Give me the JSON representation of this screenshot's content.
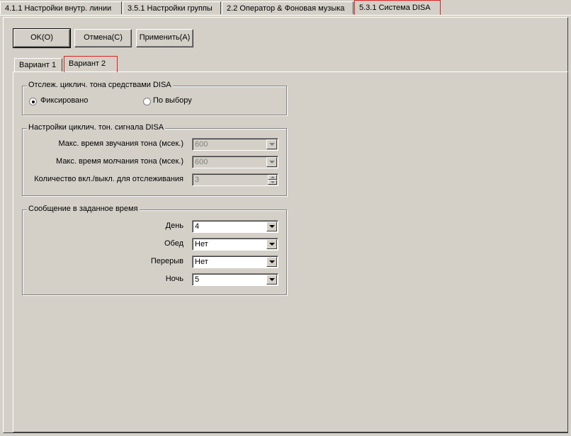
{
  "top_tabs": [
    {
      "label": "4.1.1 Настройки внутр. линии",
      "active": false
    },
    {
      "label": "3.5.1 Настройки группы",
      "active": false
    },
    {
      "label": "2.2 Оператор & Фоновая музыка",
      "active": false
    },
    {
      "label": "5.3.1 Система DISA",
      "active": true
    }
  ],
  "buttons": {
    "ok": "OK(O)",
    "cancel": "Отмена(C)",
    "apply": "Применить(A)"
  },
  "inner_tabs": [
    {
      "label": "Вариант 1",
      "active": false
    },
    {
      "label": "Вариант 2",
      "active": true
    }
  ],
  "tone_tracking": {
    "title": "Отслеж. циклич. тона средствами DISA",
    "options": [
      {
        "label": "Фиксировано",
        "selected": true
      },
      {
        "label": "По выбору",
        "selected": false
      }
    ]
  },
  "tone_settings": {
    "title": "Настройки циклич. тон. сигнала DISA",
    "rows": [
      {
        "label": "Макс. время звучания тона (мсек.)",
        "value": "600"
      },
      {
        "label": "Макс. время молчания тона (мсек.)",
        "value": "600"
      },
      {
        "label": "Количество вкл./выкл. для отслеживания",
        "value": "3"
      }
    ]
  },
  "timed_message": {
    "title": "Сообщение в заданное время",
    "rows": [
      {
        "label": "День",
        "value": "4"
      },
      {
        "label": "Обед",
        "value": "Нет"
      },
      {
        "label": "Перерыв",
        "value": "Нет"
      },
      {
        "label": "Ночь",
        "value": "5"
      }
    ]
  },
  "colors": {
    "background": "#d4d0c8",
    "highlight": "#e02020"
  }
}
